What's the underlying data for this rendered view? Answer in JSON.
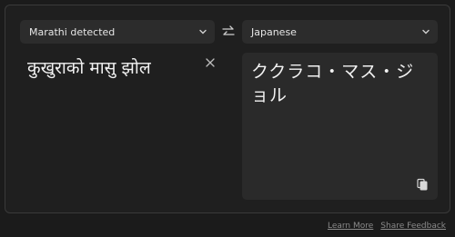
{
  "source_lang": {
    "label": "Marathi detected",
    "icon": "chevron-down-icon"
  },
  "target_lang": {
    "label": "Japanese",
    "icon": "chevron-down-icon"
  },
  "swap": {
    "icon": "swap-arrows-icon"
  },
  "source": {
    "text": "कुखुराको मासु झोल",
    "clear_icon": "close-icon"
  },
  "target": {
    "text": "ククラコ・マス・ジョル",
    "copy_icon": "copy-icon"
  },
  "footer": {
    "learn_more": "Learn More",
    "share_feedback": "Share Feedback"
  },
  "colors": {
    "background": "#1b1b1b",
    "panel": "#1f1f1f",
    "control": "#2c2c2c",
    "output_box": "#2a2a2a",
    "muted_text": "#8a8a8a"
  }
}
